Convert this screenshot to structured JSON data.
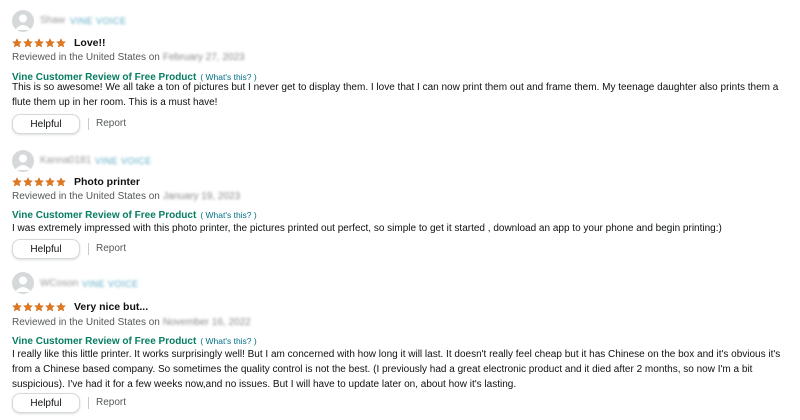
{
  "reviews": [
    {
      "profile_name": "Shaw",
      "vine_badge": "VINE VOICE",
      "title": "Love!!",
      "rating": 5,
      "reviewed_prefix": "Reviewed in the United States on",
      "date": "February 27, 2023",
      "vine_label": "Vine Customer Review of Free Product",
      "whats_this": "( What's this? )",
      "body": "This is so awesome! We all take a ton of pictures but I never get to display them. I love that I can now print them out and frame them. My teenage daughter also prints them a flute them up in her room. This is a must have!",
      "helpful_label": "Helpful",
      "report_label": "Report"
    },
    {
      "profile_name": "Kanna0181",
      "vine_badge": "VINE VOICE",
      "title": "Photo printer",
      "rating": 5,
      "reviewed_prefix": "Reviewed in the United States on",
      "date": "January 19, 2023",
      "vine_label": "Vine Customer Review of Free Product",
      "whats_this": "( What's this? )",
      "body": "I was extremely impressed with this photo printer, the pictures printed out perfect, so simple to get it started , download an app to your phone and begin printing:)",
      "helpful_label": "Helpful",
      "report_label": "Report"
    },
    {
      "profile_name": "WCoson",
      "vine_badge": "VINE VOICE",
      "title": "Very nice but...",
      "rating": 5,
      "reviewed_prefix": "Reviewed in the United States on",
      "date": "November 16, 2022",
      "vine_label": "Vine Customer Review of Free Product",
      "whats_this": "( What's this? )",
      "body": "I really like this little printer. It works surprisingly well! But I am concerned with how long it will last. It doesn't really feel cheap but it has Chinese on the box and it's obvious it's from a Chinese based company. So sometimes the quality control is not the best. (I previously had a great electronic product and it died after 2 months, so now I'm a bit suspicious). I've had it for a few weeks now,and no issues. But I will have to update later on, about how it's lasting.",
      "helpful_label": "Helpful",
      "report_label": "Report"
    }
  ],
  "colors": {
    "star": "#de7921",
    "vine_green": "#067d62",
    "link": "#007185"
  },
  "icons": {
    "avatar": "default-avatar-icon",
    "star": "star-icon"
  }
}
